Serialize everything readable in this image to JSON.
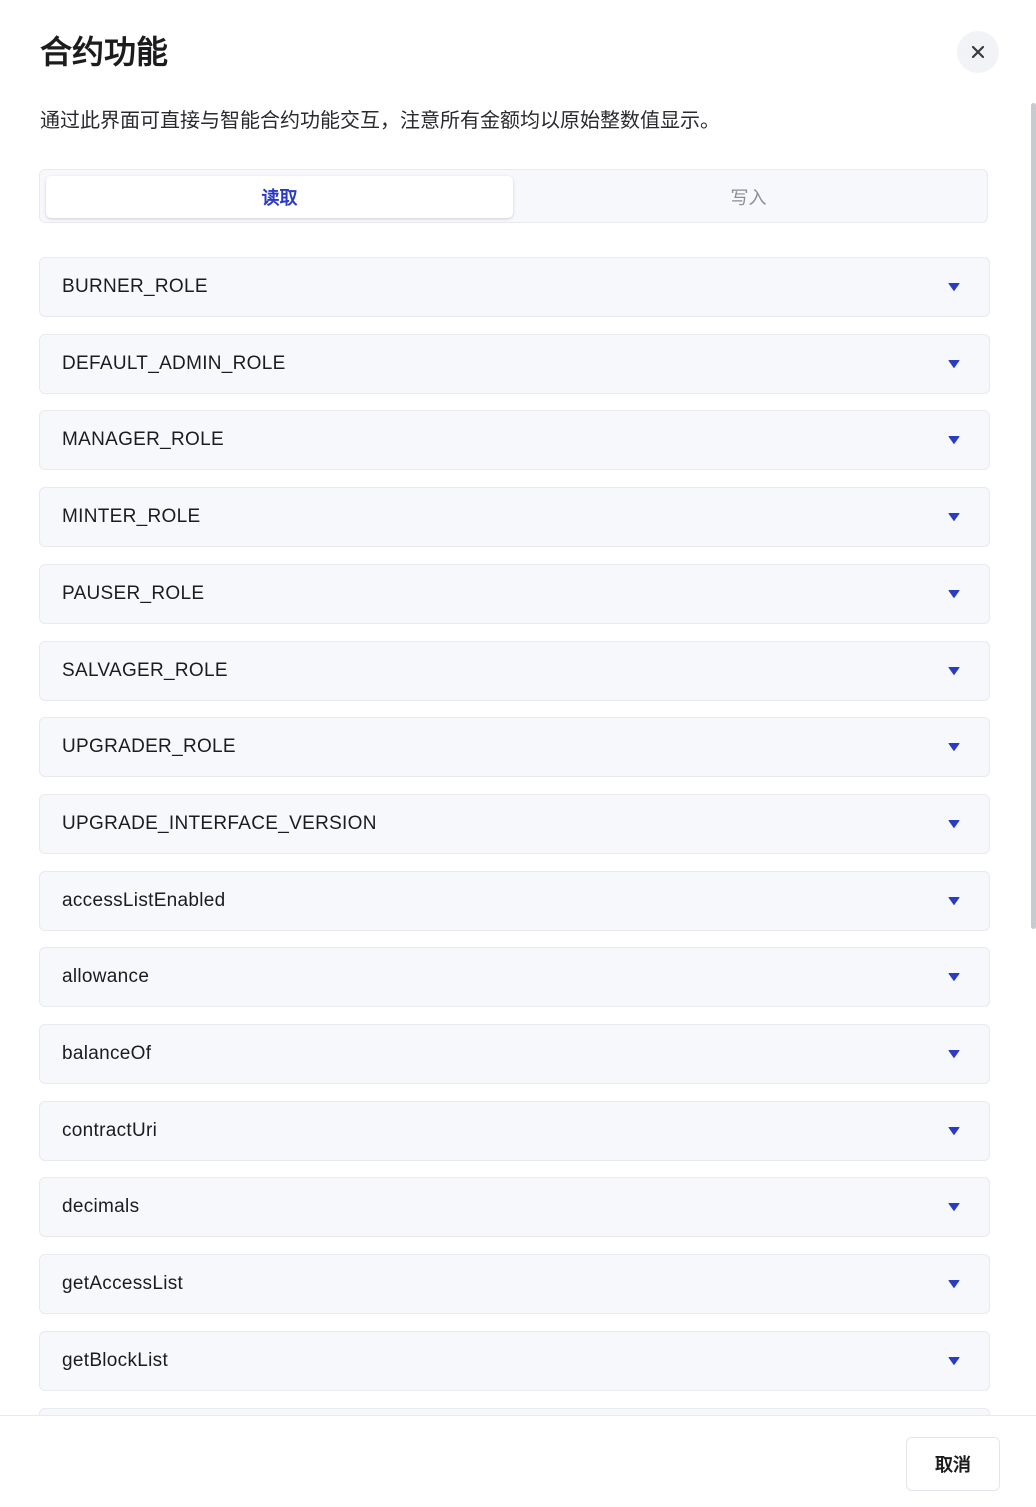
{
  "modal": {
    "title": "合约功能",
    "description": "通过此界面可直接与智能合约功能交互，注意所有金额均以原始整数值显示。",
    "close_icon": "close-icon"
  },
  "tabs": [
    {
      "label": "读取",
      "active": true
    },
    {
      "label": "写入",
      "active": false
    }
  ],
  "functions": [
    "BURNER_ROLE",
    "DEFAULT_ADMIN_ROLE",
    "MANAGER_ROLE",
    "MINTER_ROLE",
    "PAUSER_ROLE",
    "SALVAGER_ROLE",
    "UPGRADER_ROLE",
    "UPGRADE_INTERFACE_VERSION",
    "accessListEnabled",
    "allowance",
    "balanceOf",
    "contractUri",
    "decimals",
    "getAccessList",
    "getBlockList",
    ""
  ],
  "item_icon": "caret-down-icon",
  "footer": {
    "cancel_label": "取消"
  },
  "colors": {
    "accent": "#2a3bc4",
    "item_bg": "#f7f8fb",
    "border": "#e8eaef"
  }
}
